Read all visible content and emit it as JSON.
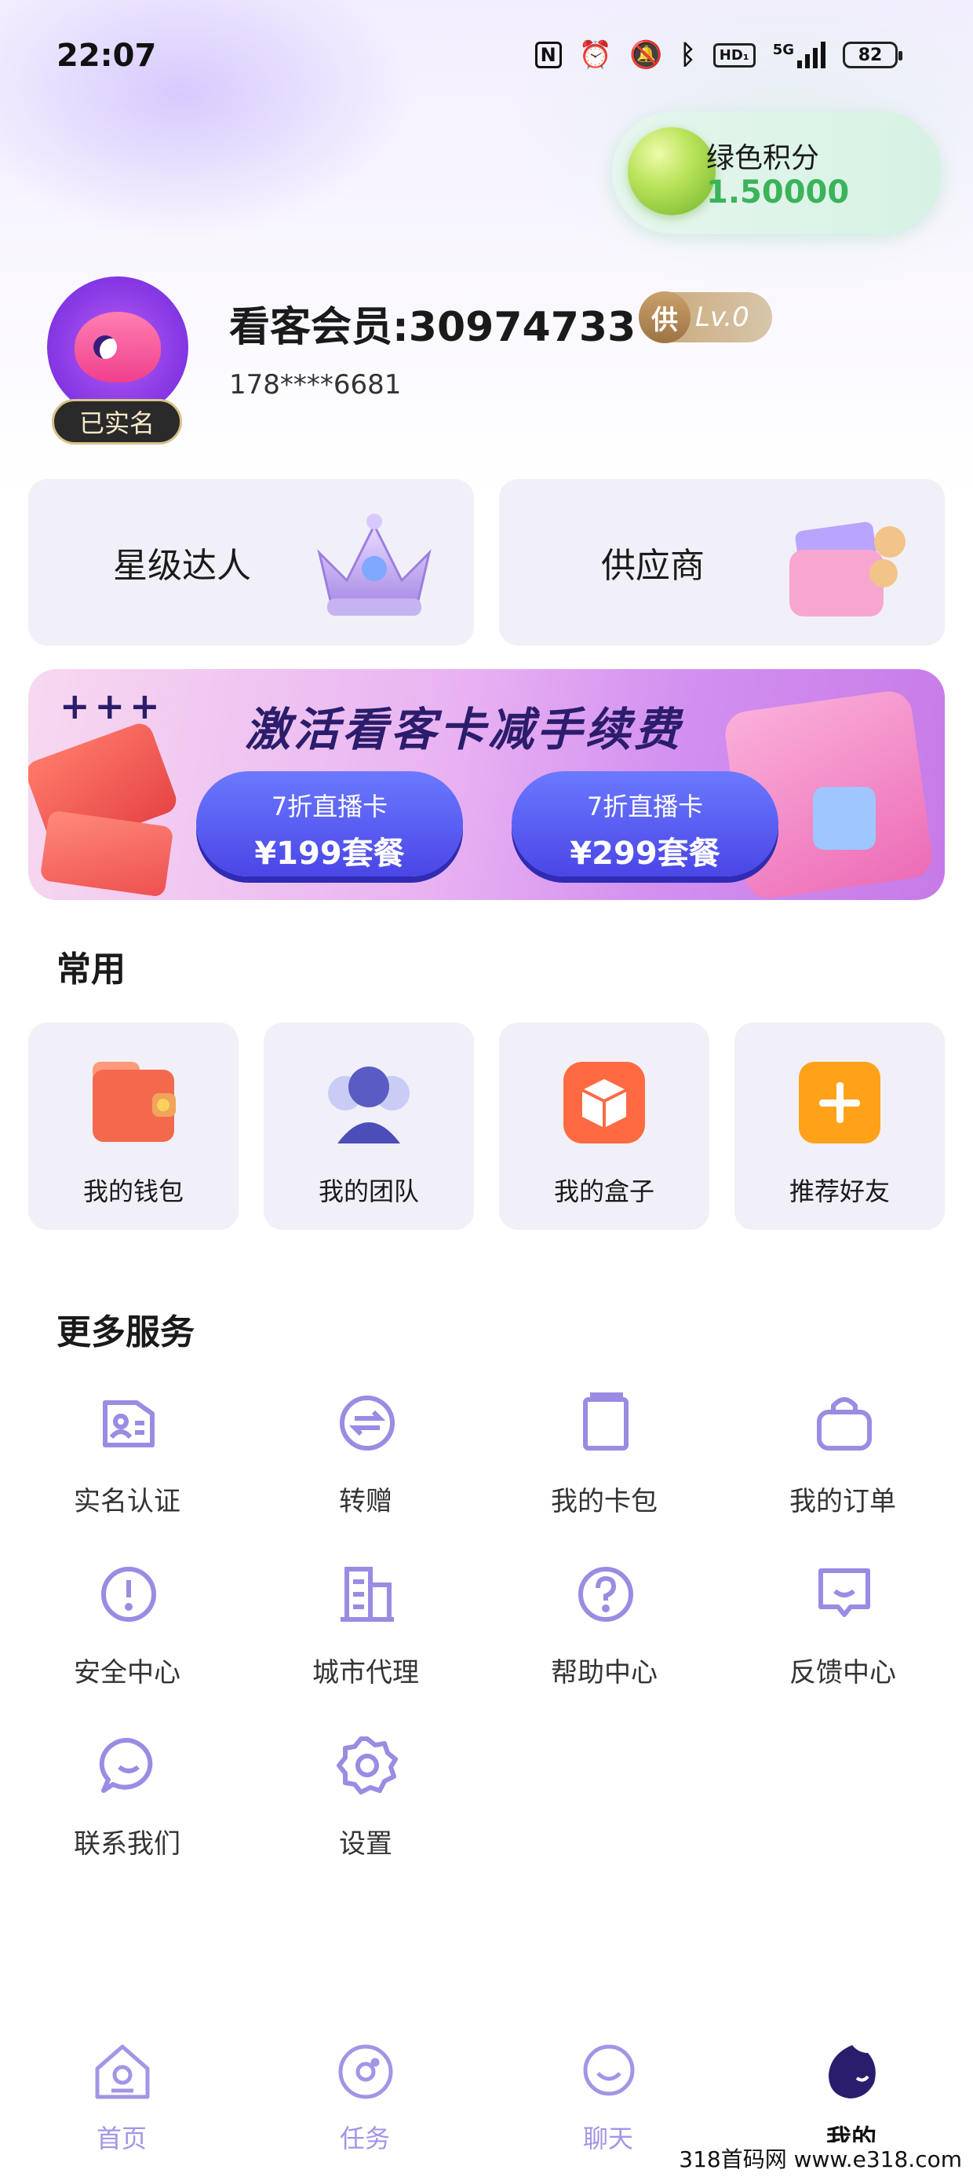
{
  "status_bar": {
    "time": "22:07",
    "network": "5G",
    "hd": "HD₁",
    "battery": "82",
    "icons": [
      "nfc-icon",
      "alarm-icon",
      "mute-icon",
      "bluetooth-icon",
      "hd-icon",
      "signal-icon",
      "battery-icon"
    ]
  },
  "green_points": {
    "label": "绿色积分",
    "value": "1.50000",
    "color": "#3bb35a"
  },
  "profile": {
    "verified": "已实名",
    "member_title": "看客会员:30974733",
    "level_badge_char": "供",
    "level": "Lv.0",
    "phone": "178****6681"
  },
  "role_cards": [
    {
      "label": "星级达人",
      "icon": "crown-icon"
    },
    {
      "label": "供应商",
      "icon": "wallet-icon"
    }
  ],
  "banner": {
    "plus": "+++",
    "title": "激活看客卡减手续费",
    "buttons": [
      {
        "line1": "7折直播卡",
        "line2": "¥199套餐"
      },
      {
        "line1": "7折直播卡",
        "line2": "¥299套餐"
      }
    ]
  },
  "common": {
    "title": "常用",
    "items": [
      {
        "label": "我的钱包",
        "icon": "wallet-icon"
      },
      {
        "label": "我的团队",
        "icon": "team-icon"
      },
      {
        "label": "我的盒子",
        "icon": "box-icon"
      },
      {
        "label": "推荐好友",
        "icon": "plus-icon"
      }
    ]
  },
  "services": {
    "title": "更多服务",
    "items": [
      {
        "label": "实名认证",
        "icon": "id-card-icon"
      },
      {
        "label": "转赠",
        "icon": "transfer-icon"
      },
      {
        "label": "我的卡包",
        "icon": "card-pack-icon"
      },
      {
        "label": "我的订单",
        "icon": "bag-icon"
      },
      {
        "label": "安全中心",
        "icon": "alert-icon"
      },
      {
        "label": "城市代理",
        "icon": "building-icon"
      },
      {
        "label": "帮助中心",
        "icon": "help-icon"
      },
      {
        "label": "反馈中心",
        "icon": "feedback-icon"
      },
      {
        "label": "联系我们",
        "icon": "chat-icon"
      },
      {
        "label": "设置",
        "icon": "gear-icon"
      }
    ]
  },
  "bottom_nav": {
    "items": [
      {
        "label": "首页",
        "icon": "home-icon"
      },
      {
        "label": "任务",
        "icon": "task-icon"
      },
      {
        "label": "聊天",
        "icon": "chat-icon"
      },
      {
        "label": "我的",
        "icon": "profile-icon"
      }
    ],
    "active_index": 3,
    "accent": "#a494e6"
  },
  "watermark": "318首码网 www.e318.com"
}
